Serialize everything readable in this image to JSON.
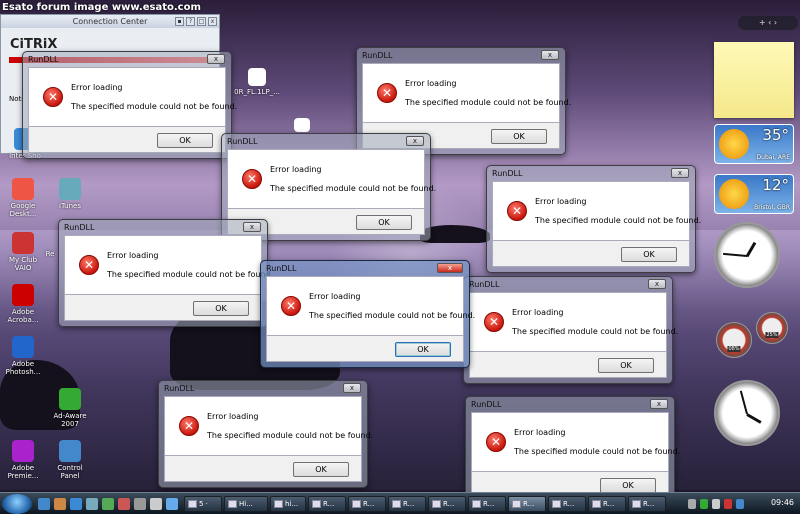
{
  "watermark": "Esato forum image www.esato.com",
  "citrix": {
    "title": "Connection Center",
    "logo": "CiTRiX",
    "notice": "Noti"
  },
  "desktop_icons": [
    {
      "label": "Inter Sho",
      "color": "#3a8ad6"
    },
    {
      "label": "Google Deskt...",
      "color": "#e54"
    },
    {
      "label": "iTunes",
      "color": "#6ab"
    },
    {
      "label": "My Club VAIO",
      "color": "#c33"
    },
    {
      "label": "Re",
      "color": "#889"
    },
    {
      "label": "Adobe Acroba...",
      "color": "#c00"
    },
    {
      "label": "Adobe Photosh...",
      "color": "#26c"
    },
    {
      "label": "Ad-Aware 2007",
      "color": "#3a3"
    },
    {
      "label": "Adobe Premie...",
      "color": "#a2c"
    },
    {
      "label": "Control Panel",
      "color": "#48c"
    },
    {
      "label": "0R_FL.1LP_...",
      "color": "#c4a"
    }
  ],
  "dialog": {
    "title": "RunDLL",
    "heading": "Error loading",
    "message": "The specified module could not be found.",
    "ok": "OK",
    "close": "x"
  },
  "sidebar": {
    "toggle": "+ ‹ ›"
  },
  "weather": [
    {
      "temp": "35°",
      "loc": "Dubai, ARE"
    },
    {
      "temp": "12°",
      "loc": "Bristol, GBR"
    }
  ],
  "meters": [
    {
      "label": "08%"
    },
    {
      "label": "25%"
    }
  ],
  "taskbar": {
    "tasks": [
      "5 ·",
      "Hi...",
      "hi...",
      "R...",
      "R...",
      "R...",
      "R...",
      "R...",
      "R...",
      "R...",
      "R...",
      "R..."
    ],
    "clock": "09:46"
  }
}
